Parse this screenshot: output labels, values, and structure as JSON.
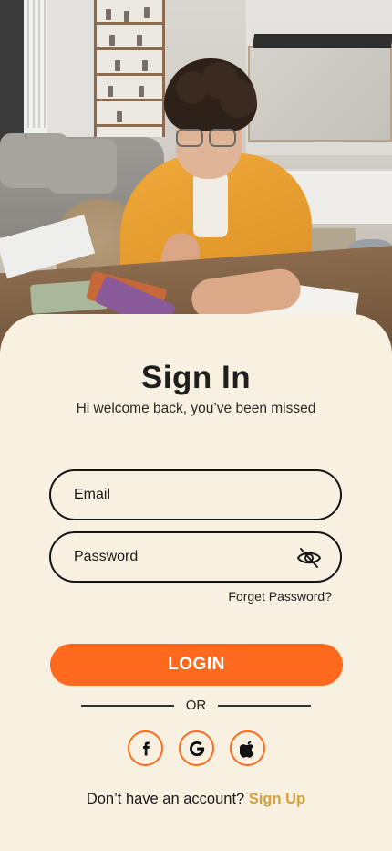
{
  "hero": {
    "image_description_icon": "hero-photo-icon"
  },
  "header": {
    "title": "Sign In",
    "subtitle": "Hi welcome back, you’ve been missed"
  },
  "form": {
    "email": {
      "placeholder": "Email",
      "value": ""
    },
    "password": {
      "placeholder": "Password",
      "value": "",
      "toggle_icon": "eye-slash-icon"
    },
    "forgot_label": "Forget Password?",
    "login_label": "LOGIN"
  },
  "divider": {
    "label": "OR"
  },
  "social": [
    {
      "name": "facebook",
      "icon": "facebook-icon"
    },
    {
      "name": "google",
      "icon": "google-icon"
    },
    {
      "name": "apple",
      "icon": "apple-icon"
    }
  ],
  "footer": {
    "prompt": "Don’t have an account?",
    "signup_label": "Sign Up"
  },
  "colors": {
    "background": "#f8f1e2",
    "accent": "#ff6a1f",
    "link": "#d5a037",
    "text": "#1f1f1f"
  }
}
